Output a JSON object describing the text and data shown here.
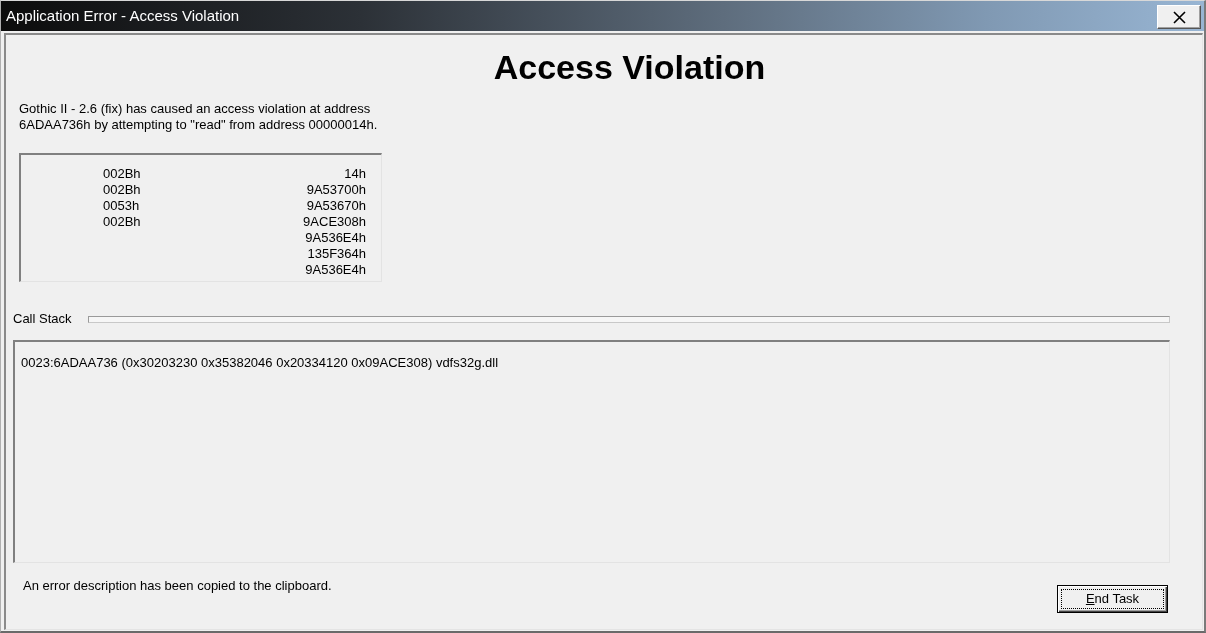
{
  "window": {
    "title": "Application Error - Access Violation"
  },
  "heading": "Access Violation",
  "message_lines": [
    "Gothic II - 2.6 (fix) has caused an access violation at address",
    "6ADAA736h by attempting to \"read\" from address 00000014h."
  ],
  "register_panel": {
    "column_1": [
      "002Bh",
      "002Bh",
      "0053h",
      "002Bh"
    ],
    "column_2": [
      "14h",
      "9A53700h",
      "9A53670h",
      "9ACE308h",
      "9A536E4h",
      "135F364h",
      "9A536E4h"
    ]
  },
  "call_stack": {
    "label": "Call Stack",
    "entries": [
      "0023:6ADAA736 (0x30203230 0x35382046 0x20334120 0x09ACE308) vdfs32g.dll"
    ]
  },
  "status_text": "An error description has been copied to the clipboard.",
  "buttons": [
    {
      "label": "End Task",
      "focused": true
    }
  ]
}
